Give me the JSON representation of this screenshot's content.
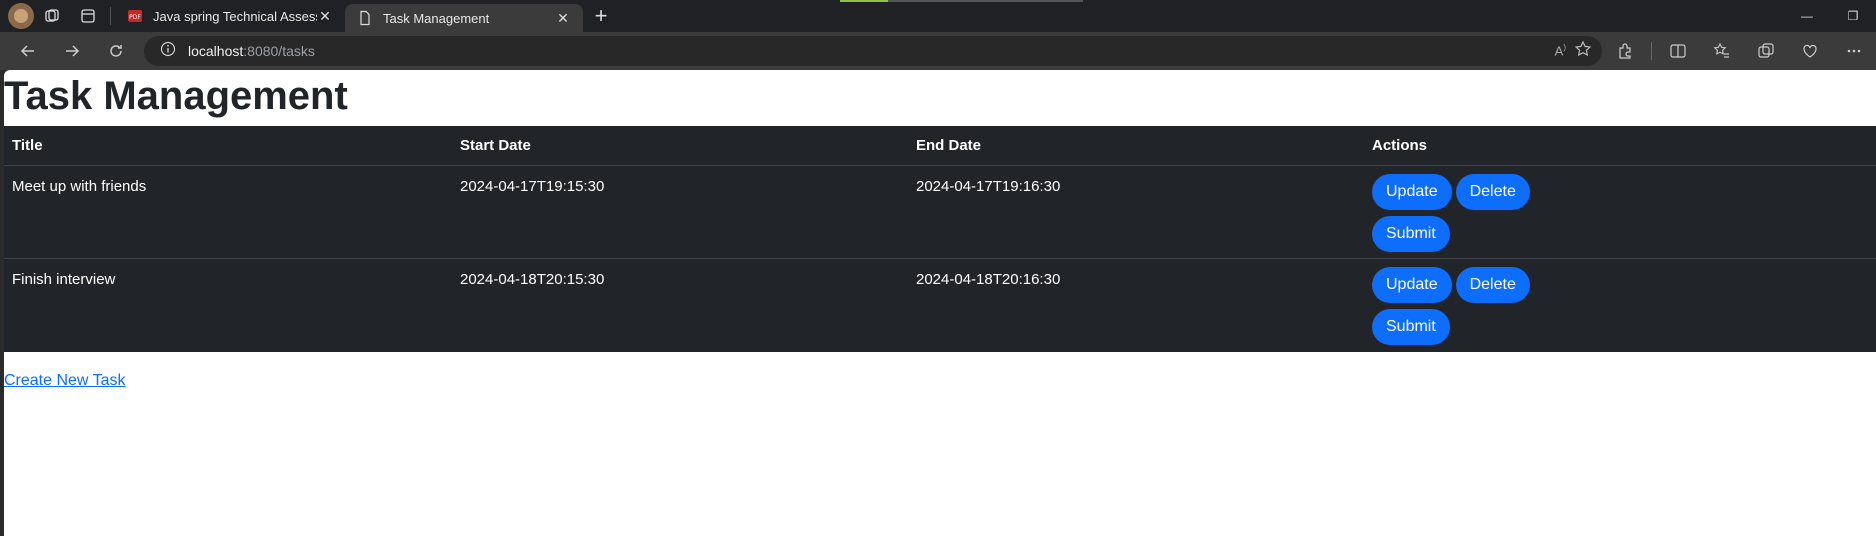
{
  "browser": {
    "tabs": [
      {
        "title": "Java spring Technical Assessment",
        "active": false,
        "favicon": "pdf-icon"
      },
      {
        "title": "Task Management",
        "active": true,
        "favicon": "page-icon"
      }
    ],
    "url_host": "localhost",
    "url_rest": ":8080/tasks"
  },
  "page": {
    "title": "Task Management",
    "columns": [
      "Title",
      "Start Date",
      "End Date",
      "Actions"
    ],
    "rows": [
      {
        "title": "Meet up with friends",
        "start": "2024-04-17T19:15:30",
        "end": "2024-04-17T19:16:30"
      },
      {
        "title": "Finish interview",
        "start": "2024-04-18T20:15:30",
        "end": "2024-04-18T20:16:30"
      }
    ],
    "buttons": {
      "update": "Update",
      "delete": "Delete",
      "submit": "Submit"
    },
    "create_link": "Create New Task"
  },
  "colors": {
    "accent": "#0d6efd",
    "table_bg": "#212529"
  }
}
